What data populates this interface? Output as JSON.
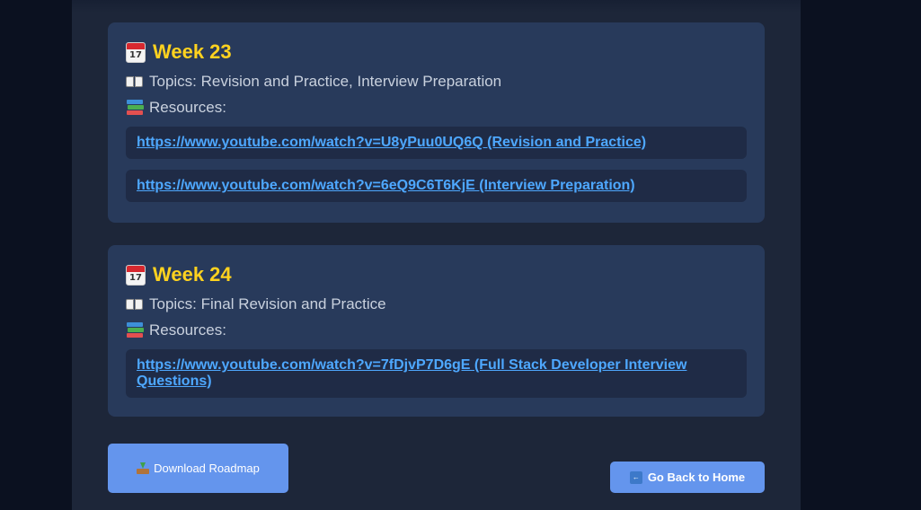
{
  "weeks": [
    {
      "title": "Week 23",
      "topics_text": "Topics: Revision and Practice, Interview Preparation",
      "resources_label": "Resources:",
      "resources": [
        "https://www.youtube.com/watch?v=U8yPuu0UQ6Q (Revision and Practice)",
        "https://www.youtube.com/watch?v=6eQ9C6T6KjE (Interview Preparation)"
      ]
    },
    {
      "title": "Week 24",
      "topics_text": "Topics: Final Revision and Practice",
      "resources_label": "Resources:",
      "resources": [
        "https://www.youtube.com/watch?v=7fDjvP7D6gE (Full Stack Developer Interview Questions)"
      ]
    }
  ],
  "calendar_icon_day": "17",
  "buttons": {
    "download_label": "Download Roadmap",
    "home_label": "Go Back to Home",
    "back_icon_text": "BACK"
  },
  "icons": {
    "calendar": "calendar-icon",
    "topics": "open-book-icon",
    "resources": "books-icon",
    "download": "inbox-tray-icon",
    "back": "back-arrow-icon"
  },
  "colors": {
    "background": "#0b1120",
    "panel": "#1d2639",
    "card": "#283a5b",
    "resource_box": "#1f2b46",
    "week_title": "#ffd21f",
    "link": "#4ea8ff",
    "button": "#6495ed"
  }
}
